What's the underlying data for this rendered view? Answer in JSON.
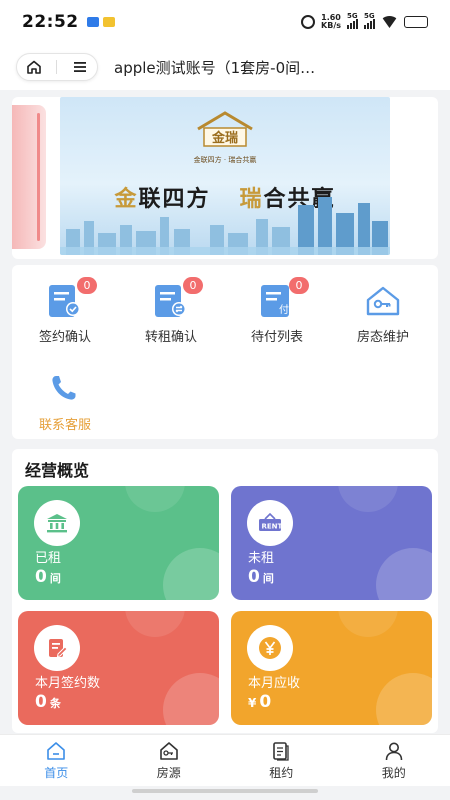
{
  "status_bar": {
    "time": "22:52",
    "net_speed": "1.60",
    "net_unit": "KB/s",
    "sim1": "5G",
    "sim2": "5G",
    "battery_icon": "battery-icon"
  },
  "header": {
    "home_icon": "home-icon",
    "menu_icon": "menu-icon",
    "title": "apple测试账号（1套房-0间…"
  },
  "banner": {
    "logo_text": "金瑞",
    "logo_sub": "金联四方 · 瑞合共赢",
    "slogan_char1": "金",
    "slogan_part1": "联四方",
    "slogan_char2": "瑞",
    "slogan_part2": "合共赢"
  },
  "actions": [
    {
      "label": "签约确认",
      "badge": "0",
      "icon": "contract-check-icon"
    },
    {
      "label": "转租确认",
      "badge": "0",
      "icon": "sublet-transfer-icon"
    },
    {
      "label": "待付列表",
      "badge": "0",
      "icon": "payment-list-icon"
    },
    {
      "label": "房态维护",
      "icon": "key-maintenance-icon"
    },
    {
      "label": "联系客服",
      "icon": "phone-icon"
    }
  ],
  "overview": {
    "title": "经营概览",
    "cards": [
      {
        "label": "已租",
        "value": "0",
        "unit": "间",
        "color": "#5bc08a",
        "icon": "bank-icon"
      },
      {
        "label": "未租",
        "value": "0",
        "unit": "间",
        "color": "#6f74cf",
        "icon": "rent-sign-icon"
      },
      {
        "label": "本月签约数",
        "value": "0",
        "unit": "条",
        "color": "#ea6a5d",
        "icon": "edit-document-icon"
      },
      {
        "label": "本月应收",
        "currency": "¥",
        "value": "0",
        "color": "#f2a52c",
        "icon": "yen-icon"
      }
    ]
  },
  "tabbar": [
    {
      "label": "首页",
      "active": true,
      "icon": "home-tab-icon"
    },
    {
      "label": "房源",
      "icon": "house-key-icon"
    },
    {
      "label": "租约",
      "icon": "lease-doc-icon"
    },
    {
      "label": "我的",
      "icon": "user-icon"
    }
  ],
  "colors": {
    "accent": "#3b8ee8",
    "badge": "#f26d6d",
    "service": "#e6a03a"
  }
}
